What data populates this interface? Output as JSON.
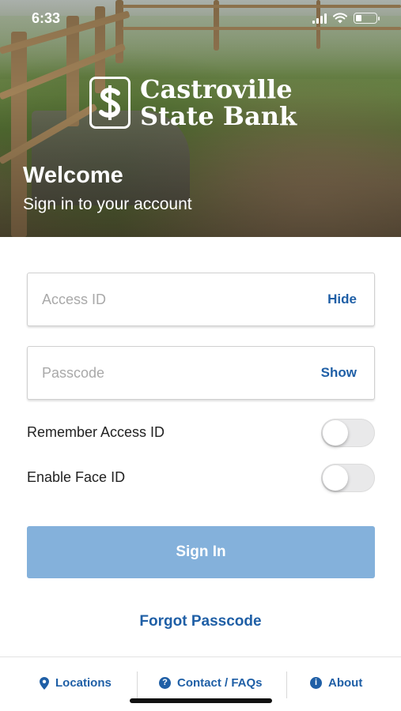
{
  "status_bar": {
    "time": "6:33",
    "icons": [
      "cellular-signal-icon",
      "wifi-icon",
      "battery-icon"
    ]
  },
  "hero": {
    "logo": {
      "icon": "dollar-shield-icon",
      "line1": "Castroville",
      "line2": "State Bank"
    },
    "welcome": "Welcome",
    "subtitle": "Sign in to your account"
  },
  "form": {
    "access_id": {
      "placeholder": "Access ID",
      "value": "",
      "toggle_label": "Hide"
    },
    "passcode": {
      "placeholder": "Passcode",
      "value": "",
      "toggle_label": "Show"
    },
    "remember_access_id": {
      "label": "Remember Access ID",
      "enabled": false
    },
    "enable_face_id": {
      "label": "Enable Face ID",
      "enabled": false
    },
    "sign_in_label": "Sign In",
    "forgot_passcode_label": "Forgot Passcode"
  },
  "footer": {
    "items": [
      {
        "label": "Locations",
        "icon": "map-pin-icon"
      },
      {
        "label": "Contact / FAQs",
        "icon": "question-circle-icon",
        "glyph": "?"
      },
      {
        "label": "About",
        "icon": "info-circle-icon",
        "glyph": "i"
      }
    ]
  },
  "colors": {
    "accent": "#1f5fa6",
    "sign_in_button": "#84b1db",
    "switch_off": "#e9e9ea"
  }
}
